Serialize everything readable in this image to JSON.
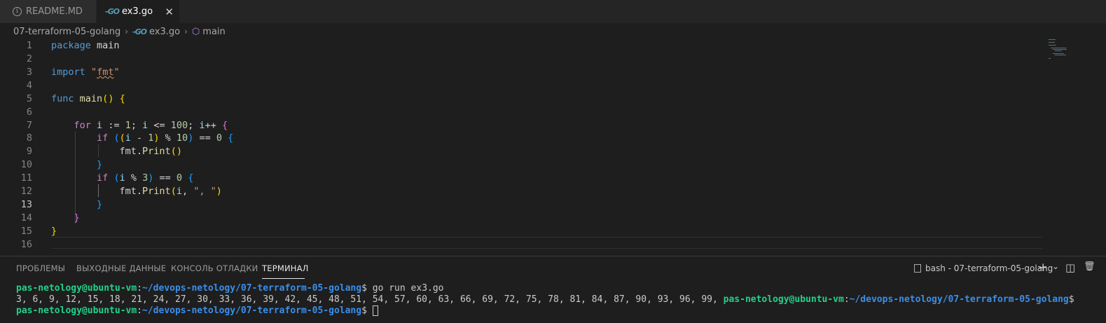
{
  "tabs": [
    {
      "label": "README.MD",
      "icon": "info-icon",
      "active": false
    },
    {
      "label": "ex3.go",
      "icon": "go-file-icon",
      "active": true
    }
  ],
  "breadcrumb": {
    "folder": "07-terraform-05-golang",
    "file": "ex3.go",
    "symbol": "main"
  },
  "editor": {
    "current_line": 13,
    "line_numbers": [
      "1",
      "2",
      "3",
      "4",
      "5",
      "6",
      "7",
      "8",
      "9",
      "10",
      "11",
      "12",
      "13",
      "14",
      "15",
      "16"
    ],
    "lines": [
      "package main",
      "",
      "import \"fmt\"",
      "",
      "func main() {",
      "",
      "    for i := 1; i <= 100; i++ {",
      "        if ((i - 1) % 10) == 0 {",
      "            fmt.Print()",
      "        }",
      "        if (i % 3) == 0 {",
      "            fmt.Print(i, \", \")",
      "        }",
      "    }",
      "}",
      ""
    ]
  },
  "panel": {
    "tabs": [
      "ПРОБЛЕМЫ",
      "ВЫХОДНЫЕ ДАННЫЕ",
      "КОНСОЛЬ ОТЛАДКИ",
      "ТЕРМИНАЛ"
    ],
    "active_tab": "ТЕРМИНАЛ",
    "terminal_name": "bash - 07-terraform-05-golang",
    "actions": {
      "new": "+",
      "dropdown": "⌄",
      "split": "◫",
      "trash": "🗑"
    }
  },
  "terminal": {
    "user": "pas-netology@ubuntu-vm",
    "path": "~/devops-netology/07-terraform-05-golang",
    "command": "go run ex3.go",
    "output": "3, 6, 9, 12, 15, 18, 21, 24, 27, 30, 33, 36, 39, 42, 45, 48, 51, 54, 57, 60, 63, 66, 69, 72, 75, 78, 81, 84, 87, 90, 93, 96, 99, "
  }
}
